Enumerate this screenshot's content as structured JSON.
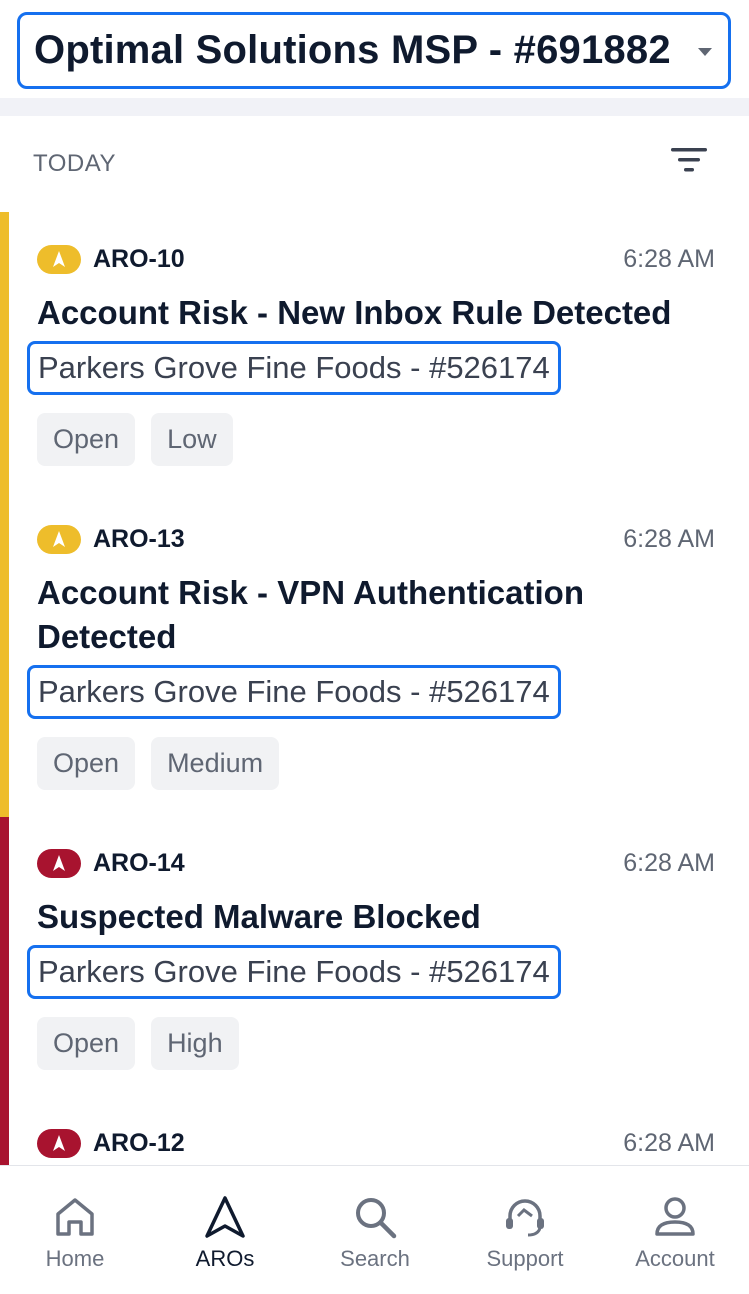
{
  "header": {
    "org_selector": "Optimal Solutions MSP - #691882"
  },
  "section": {
    "title": "TODAY"
  },
  "aros": [
    {
      "id": "ARO-10",
      "time": "6:28 AM",
      "title": "Account Risk - New Inbox Rule Detected",
      "company": "Parkers Grove Fine Foods - #526174",
      "status": "Open",
      "severity": "Low",
      "severity_color": "#eebd2b"
    },
    {
      "id": "ARO-13",
      "time": "6:28 AM",
      "title": "Account Risk - VPN Authentication Detected",
      "company": "Parkers Grove Fine Foods - #526174",
      "status": "Open",
      "severity": "Medium",
      "severity_color": "#eebd2b"
    },
    {
      "id": "ARO-14",
      "time": "6:28 AM",
      "title": "Suspected Malware Blocked",
      "company": "Parkers Grove Fine Foods - #526174",
      "status": "Open",
      "severity": "High",
      "severity_color": "#a8132f"
    },
    {
      "id": "ARO-12",
      "time": "6:28 AM",
      "severity_color": "#a8132f"
    }
  ],
  "nav": {
    "home": "Home",
    "aros": "AROs",
    "search": "Search",
    "support": "Support",
    "account": "Account",
    "active": "AROs"
  },
  "colors": {
    "accent": "#1570ef",
    "medium": "#eebd2b",
    "high": "#a8132f"
  }
}
